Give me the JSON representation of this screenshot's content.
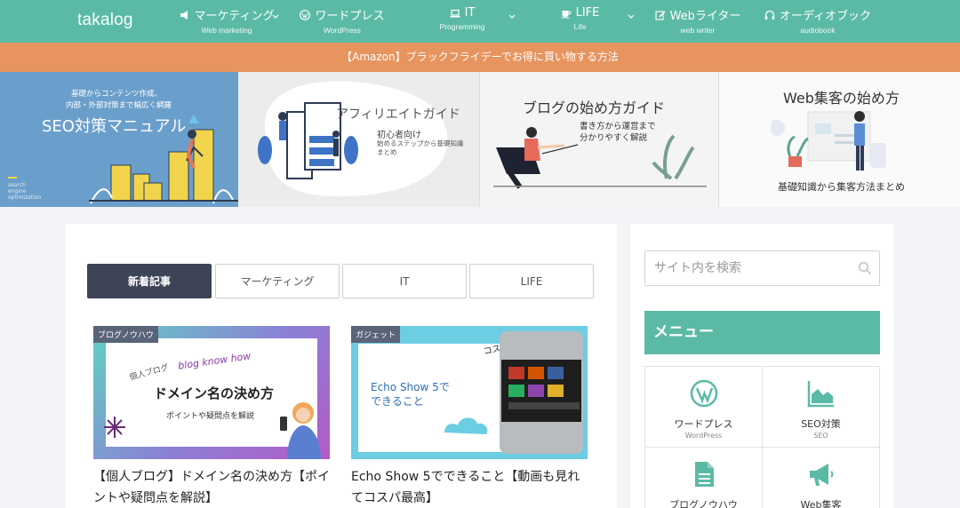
{
  "header": {
    "logo": "takalog",
    "nav": [
      {
        "label": "マーケティング",
        "sub": "Web marketing"
      },
      {
        "label": "ワードプレス",
        "sub": "WordPress"
      },
      {
        "label": "IT",
        "sub": "Programming"
      },
      {
        "label": "LIFE",
        "sub": "Life"
      },
      {
        "label": "Webライター",
        "sub": "web writer"
      },
      {
        "label": "オーディオブック",
        "sub": "audiobook"
      }
    ]
  },
  "announcement": "【Amazon】ブラックフライデーでお得に買い物する方法",
  "banners": {
    "seo": {
      "line1": "基礎からコンテンツ作成、",
      "line2": "内部・外部対策まで幅広く網羅",
      "title": "SEO対策マニュアル",
      "tag1": "search",
      "tag2": "engine",
      "tag3": "optimization"
    },
    "affiliate": {
      "title": "アフィリエイトガイド",
      "sub1": "初心者向け",
      "sub2": "始めるステップから基礎知識",
      "sub3": "まとめ"
    },
    "blog": {
      "title": "ブログの始め方ガイド",
      "sub1": "書き方から運営まで",
      "sub2": "分かりやすく解説"
    },
    "web": {
      "title": "Web集客の始め方",
      "sub": "基礎知識から集客方法まとめ"
    }
  },
  "tabs": [
    {
      "label": "新着記事",
      "active": true
    },
    {
      "label": "マーケティング",
      "active": false
    },
    {
      "label": "IT",
      "active": false
    },
    {
      "label": "LIFE",
      "active": false
    }
  ],
  "articles": [
    {
      "category": "ブログノウハウ",
      "thumb_handwrite1": "個人ブログ",
      "thumb_handwrite2": "blog know how",
      "thumb_title": "ドメイン名の決め方",
      "thumb_sub": "ポイントや疑問点を解説",
      "title": "【個人ブログ】ドメイン名の決め方【ポイントや疑問点を解説】"
    },
    {
      "category": "ガジェット",
      "thumb_handwrite": "コスパ最高",
      "thumb_title1": "Echo Show 5で",
      "thumb_title2": "できること",
      "title": "Echo Show 5でできること【動画も見れてコスパ最高】"
    }
  ],
  "sidebar": {
    "search_placeholder": "サイト内を検索",
    "menu_title": "メニュー",
    "menu_items": [
      {
        "label": "ワードプレス",
        "sub": "WordPress",
        "icon": "wordpress-icon"
      },
      {
        "label": "SEO対策",
        "sub": "SEO",
        "icon": "area-chart-icon"
      },
      {
        "label": "ブログノウハウ",
        "sub": "",
        "icon": "document-icon"
      },
      {
        "label": "Web集客",
        "sub": "",
        "icon": "megaphone-icon"
      }
    ]
  },
  "colors": {
    "header": "#5bbaa6",
    "announcement": "#e7945f",
    "active_tab": "#3d4457"
  }
}
